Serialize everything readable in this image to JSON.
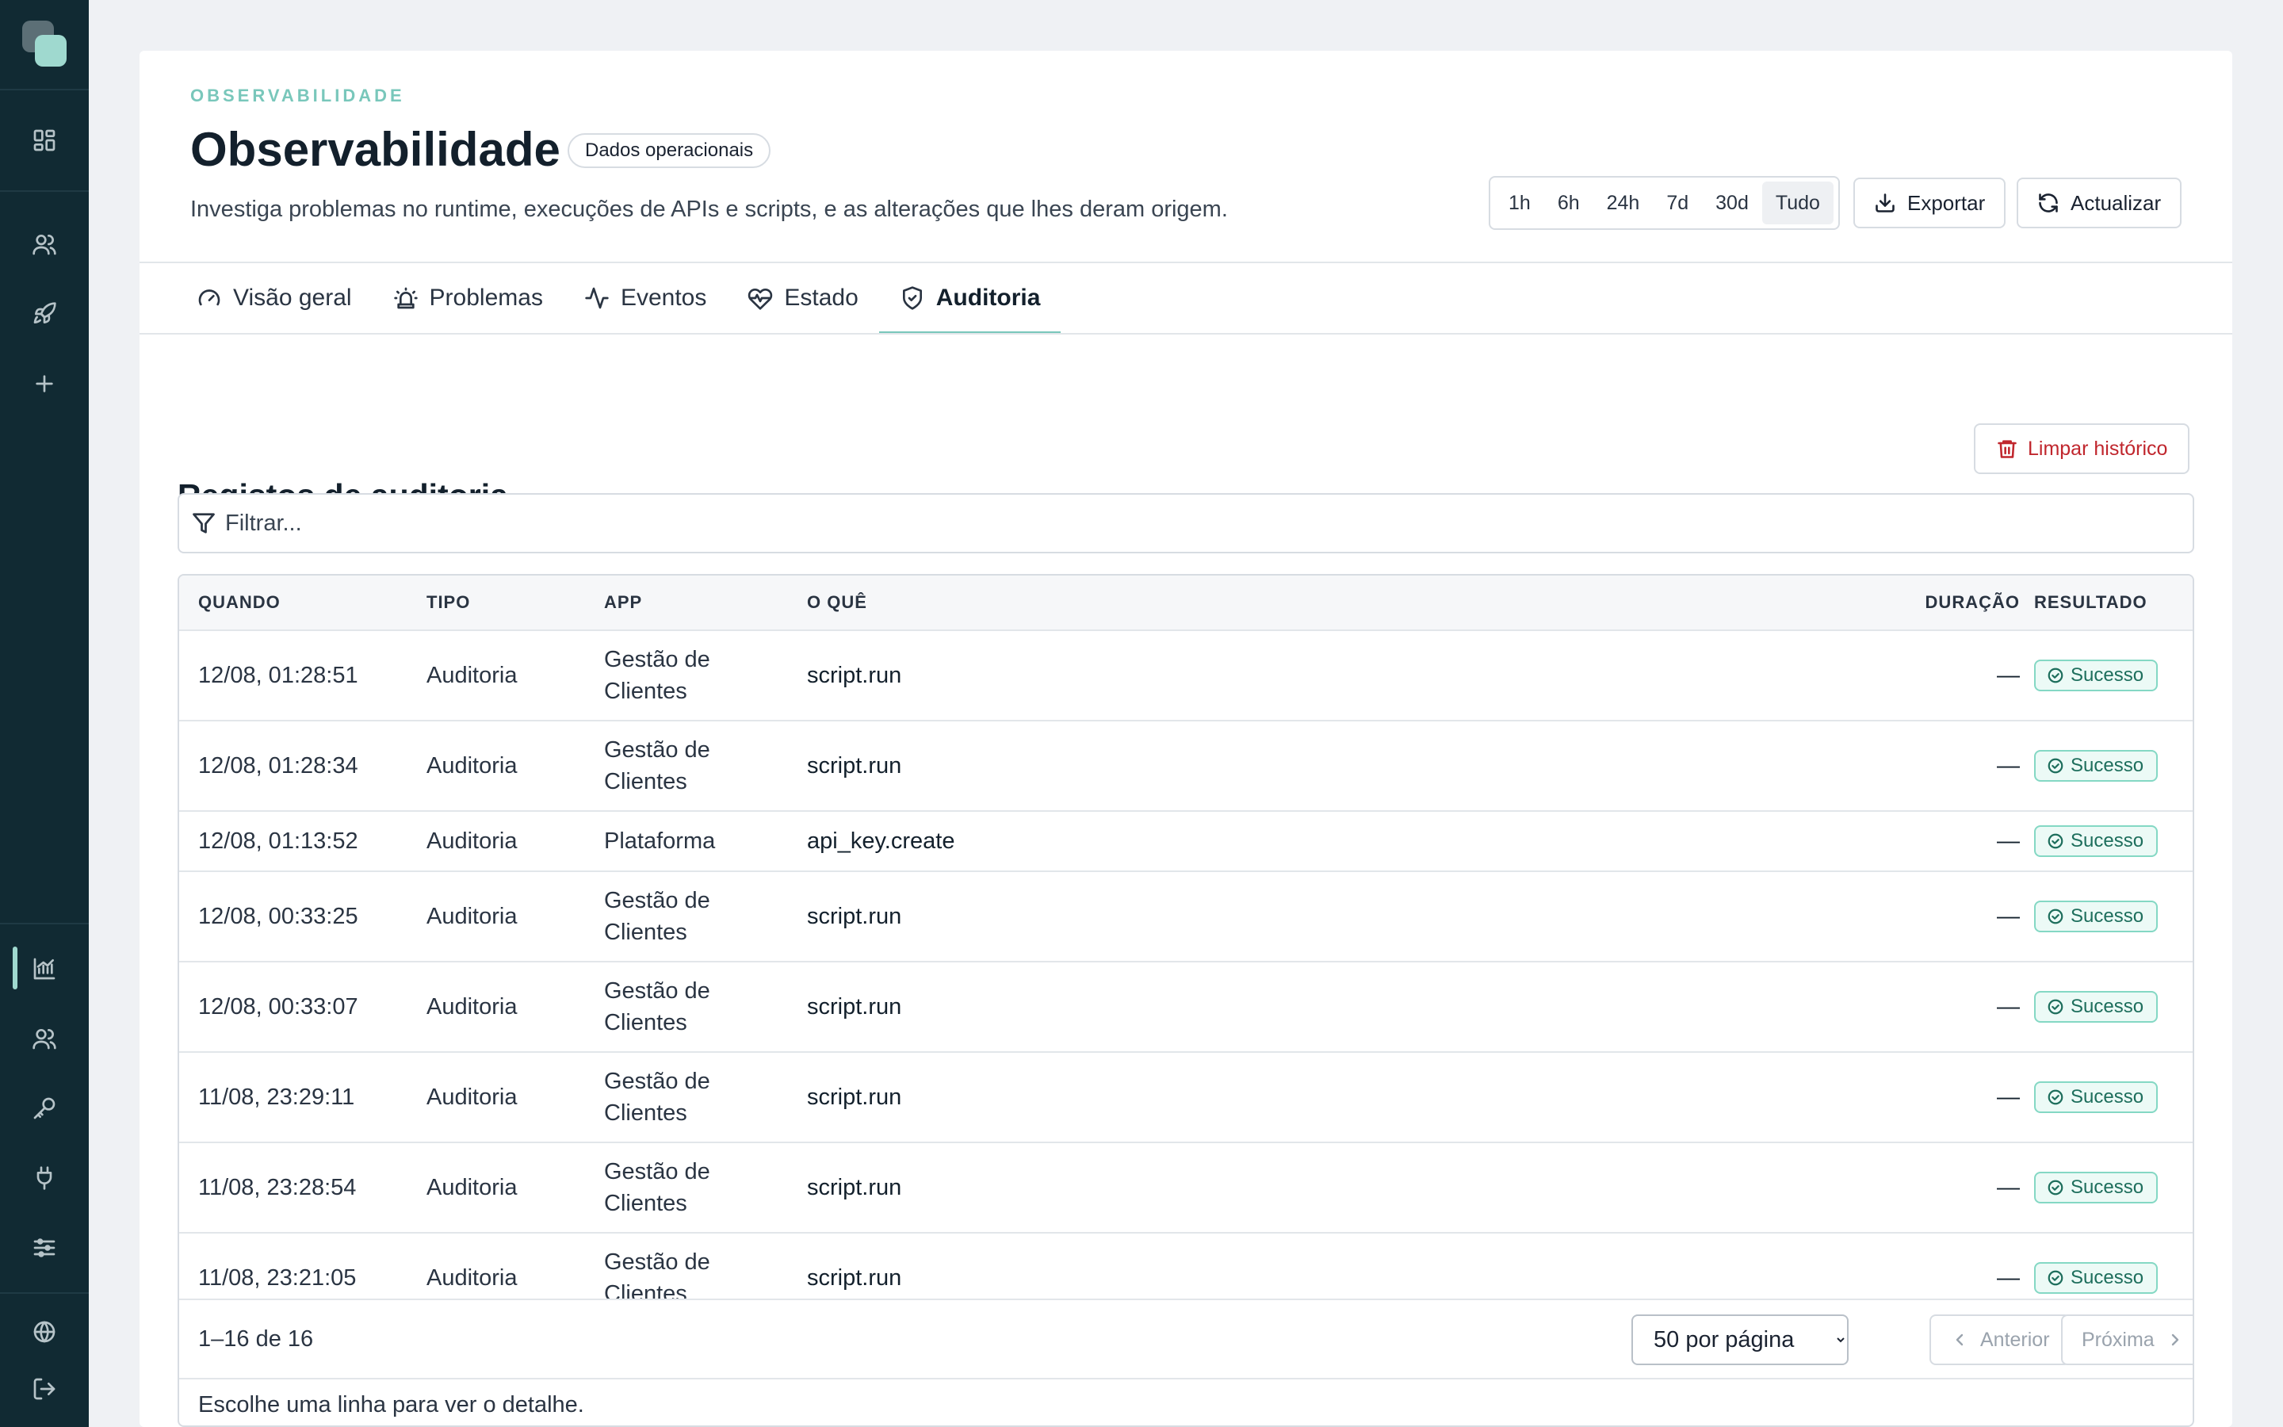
{
  "sidebar": {
    "top_icons": [
      "grid-icon",
      "users-icon",
      "rocket-icon",
      "plus-icon"
    ],
    "bottom_icons": [
      "analytics-icon",
      "team-icon",
      "key-icon",
      "plug-icon",
      "sliders-icon"
    ],
    "footer_icons": [
      "globe-icon",
      "logout-icon"
    ],
    "active": "analytics-icon",
    "accent": "#9fd9cf"
  },
  "header": {
    "eyebrow": "OBSERVABILIDADE",
    "title": "Observabilidade",
    "chip": "Dados operacionais",
    "subtitle": "Investiga problemas no runtime, execuções de APIs e scripts, e as alterações que lhes deram origem.",
    "ranges": [
      "1h",
      "6h",
      "24h",
      "7d",
      "30d",
      "Tudo"
    ],
    "active_range": "Tudo",
    "export_label": "Exportar",
    "refresh_label": "Actualizar"
  },
  "tabs": [
    {
      "label": "Visão geral",
      "icon": "gauge-icon"
    },
    {
      "label": "Problemas",
      "icon": "siren-icon"
    },
    {
      "label": "Eventos",
      "icon": "activity-icon"
    },
    {
      "label": "Estado",
      "icon": "heart-pulse-icon"
    },
    {
      "label": "Auditoria",
      "icon": "shield-check-icon"
    }
  ],
  "active_tab": "Auditoria",
  "audit": {
    "title": "Registos de auditoria",
    "clear_label": "Limpar histórico",
    "filter_placeholder": "Filtrar...",
    "columns": {
      "when": "QUANDO",
      "type": "TIPO",
      "app": "APP",
      "what": "O QUÊ",
      "duration": "DURAÇÃO",
      "result": "RESULTADO"
    },
    "rows": [
      {
        "when": "12/08, 01:28:51",
        "type": "Auditoria",
        "app": "Gestão de Clientes",
        "what": "script.run",
        "duration": "—",
        "result": "Sucesso"
      },
      {
        "when": "12/08, 01:28:34",
        "type": "Auditoria",
        "app": "Gestão de Clientes",
        "what": "script.run",
        "duration": "—",
        "result": "Sucesso"
      },
      {
        "when": "12/08, 01:13:52",
        "type": "Auditoria",
        "app": "Plataforma",
        "what": "api_key.create",
        "duration": "—",
        "result": "Sucesso"
      },
      {
        "when": "12/08, 00:33:25",
        "type": "Auditoria",
        "app": "Gestão de Clientes",
        "what": "script.run",
        "duration": "—",
        "result": "Sucesso"
      },
      {
        "when": "12/08, 00:33:07",
        "type": "Auditoria",
        "app": "Gestão de Clientes",
        "what": "script.run",
        "duration": "—",
        "result": "Sucesso"
      },
      {
        "when": "11/08, 23:29:11",
        "type": "Auditoria",
        "app": "Gestão de Clientes",
        "what": "script.run",
        "duration": "—",
        "result": "Sucesso"
      },
      {
        "when": "11/08, 23:28:54",
        "type": "Auditoria",
        "app": "Gestão de Clientes",
        "what": "script.run",
        "duration": "—",
        "result": "Sucesso"
      },
      {
        "when": "11/08, 23:21:05",
        "type": "Auditoria",
        "app": "Gestão de Clientes",
        "what": "script.run",
        "duration": "—",
        "result": "Sucesso"
      }
    ],
    "pagination": {
      "range_text": "1–16 de 16",
      "per_page": "50 por página",
      "prev_label": "Anterior",
      "next_label": "Próxima"
    },
    "detail_hint": "Escolhe uma linha para ver o detalhe."
  },
  "colors": {
    "accent": "#79c7bb",
    "sidebar_bg": "#112a33",
    "danger": "#c0262d",
    "success": "#1d6e5c"
  }
}
